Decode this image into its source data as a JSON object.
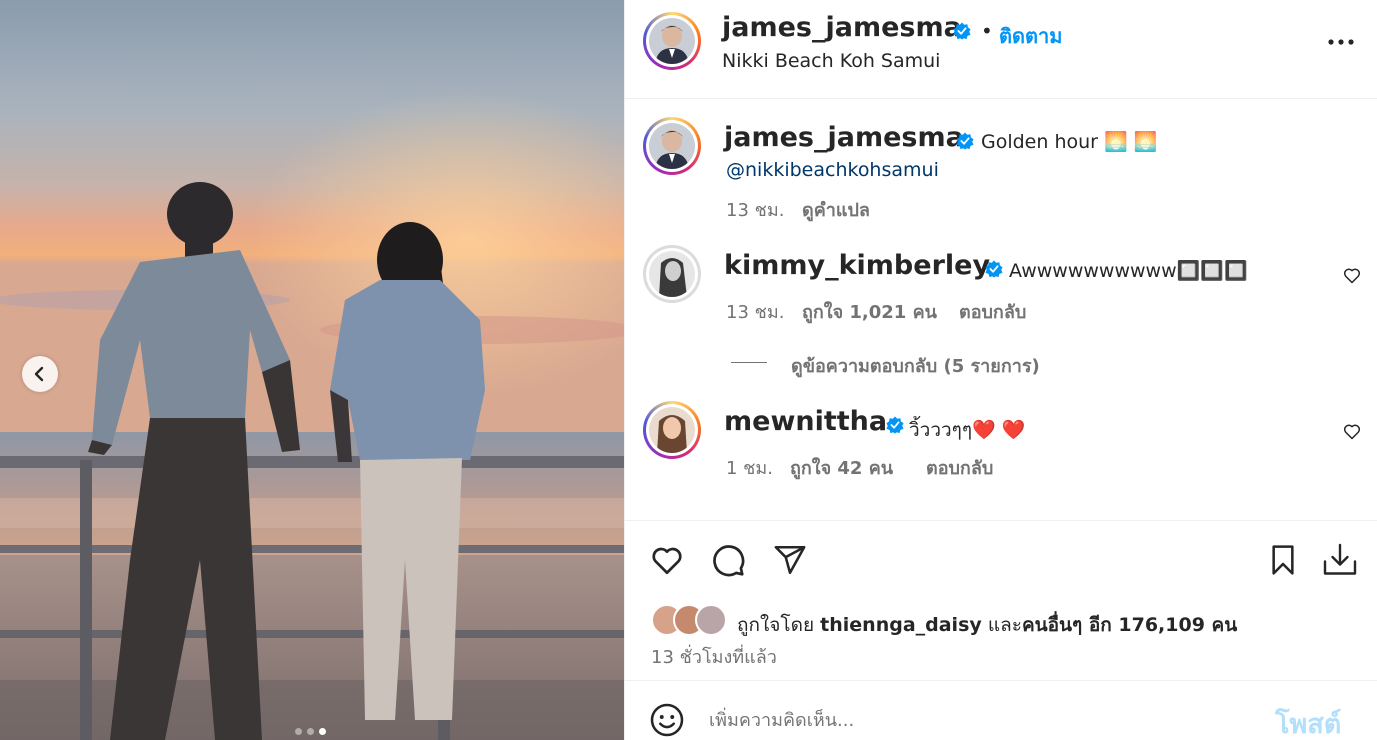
{
  "header": {
    "username": "james_jamesma",
    "separator": "•",
    "follow_label": "ติดตาม",
    "location": "Nikki Beach Koh Samui",
    "more_icon": "more-horizontal-icon"
  },
  "caption": {
    "username": "james_jamesma",
    "text": "Golden hour 🌅 🌅",
    "mention": "@nikkibeachkohsamui",
    "time": "13 ชม.",
    "translate_label": "ดูคำแปล"
  },
  "comments": [
    {
      "username": "kimmy_kimberley",
      "text": "Awwwwwwwwww🔲🔲🔲",
      "time": "13 ชม.",
      "likes": "ถูกใจ 1,021 คน",
      "reply_label": "ตอบกลับ",
      "view_replies": "ดูข้อความตอบกลับ (5 รายการ)"
    },
    {
      "username": "mewnittha",
      "text": "วิ้วววๆๆ❤️ ❤️",
      "time": "1 ชม.",
      "likes": "ถูกใจ 42 คน",
      "reply_label": "ตอบกลับ"
    }
  ],
  "actions": {
    "like_icon": "heart-icon",
    "comment_icon": "comment-icon",
    "share_icon": "send-icon",
    "save_icon": "bookmark-icon",
    "download_icon": "download-icon"
  },
  "likes_summary": {
    "prefix": "ถูกใจโดย",
    "user": "thiennga_daisy",
    "middle": "และ",
    "others": "คนอื่นๆ อีก 176,109 คน"
  },
  "post_time": "13 ชั่วโมงที่แล้ว",
  "comment_box": {
    "placeholder": "เพิ่มความคิดเห็น...",
    "post_label": "โพสต์",
    "emoji_icon": "emoji-icon"
  },
  "carousel": {
    "dots": 3,
    "active_index": 2
  },
  "colors": {
    "accent": "#0095f6",
    "verified": "#0095f6",
    "post_disabled": "#b2dffc"
  }
}
